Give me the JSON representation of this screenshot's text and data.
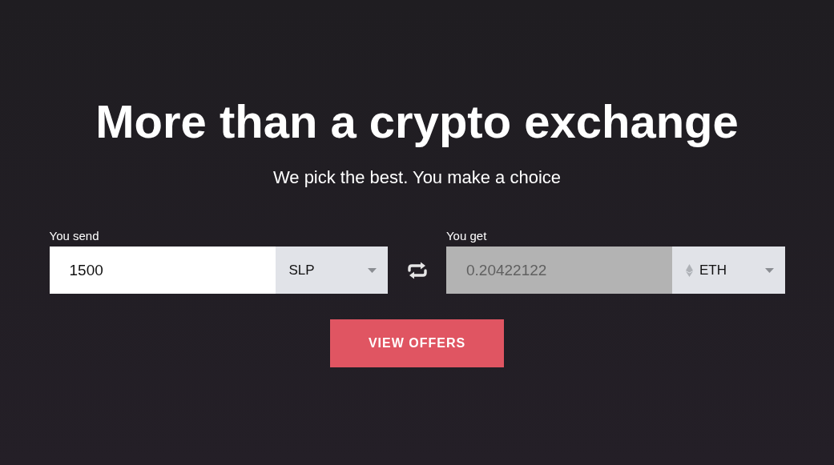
{
  "heading": "More than a crypto exchange",
  "subtitle": "We pick the best. You make a choice",
  "send": {
    "label": "You send",
    "value": "1500",
    "currency": "SLP",
    "disabled": false,
    "coin_icon": false
  },
  "get": {
    "label": "You get",
    "value": "0.20422122",
    "currency": "ETH",
    "disabled": true,
    "coin_icon": true
  },
  "button": "VIEW OFFERS"
}
